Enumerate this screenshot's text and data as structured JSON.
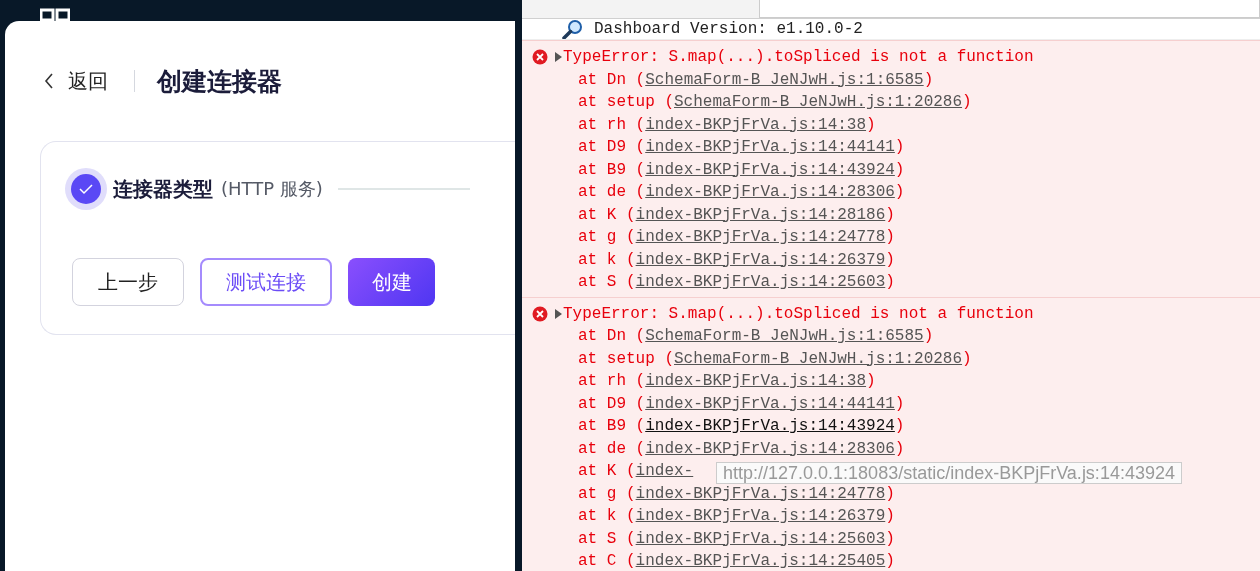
{
  "header": {
    "back_label": "返回",
    "title": "创建连接器"
  },
  "steps": [
    {
      "title": "连接器类型",
      "detail": "(HTTP 服务)",
      "done": true
    }
  ],
  "buttons": [
    {
      "label": "上一步",
      "kind": "default"
    },
    {
      "label": "测试连接",
      "kind": "outline"
    },
    {
      "label": "创建",
      "kind": "primary"
    }
  ],
  "console": {
    "info": "Dashboard Version: e1.10.0-2",
    "errors": [
      {
        "message": "TypeError: S.map(...).toSpliced is not a function",
        "frames": [
          {
            "at": "at Dn (",
            "source": "SchemaForm-B_JeNJwH.js:1:6585",
            "close": ")",
            "hovered": false
          },
          {
            "at": "at setup (",
            "source": "SchemaForm-B_JeNJwH.js:1:20286",
            "close": ")",
            "hovered": false
          },
          {
            "at": "at rh (",
            "source": "index-BKPjFrVa.js:14:38",
            "close": ")",
            "hovered": false
          },
          {
            "at": "at D9 (",
            "source": "index-BKPjFrVa.js:14:44141",
            "close": ")",
            "hovered": false
          },
          {
            "at": "at B9 (",
            "source": "index-BKPjFrVa.js:14:43924",
            "close": ")",
            "hovered": false
          },
          {
            "at": "at de (",
            "source": "index-BKPjFrVa.js:14:28306",
            "close": ")",
            "hovered": false
          },
          {
            "at": "at K (",
            "source": "index-BKPjFrVa.js:14:28186",
            "close": ")",
            "hovered": false
          },
          {
            "at": "at g (",
            "source": "index-BKPjFrVa.js:14:24778",
            "close": ")",
            "hovered": false
          },
          {
            "at": "at k (",
            "source": "index-BKPjFrVa.js:14:26379",
            "close": ")",
            "hovered": false
          },
          {
            "at": "at S (",
            "source": "index-BKPjFrVa.js:14:25603",
            "close": ")",
            "hovered": false
          }
        ]
      },
      {
        "message": "TypeError: S.map(...).toSpliced is not a function",
        "frames": [
          {
            "at": "at Dn (",
            "source": "SchemaForm-B_JeNJwH.js:1:6585",
            "close": ")",
            "hovered": false
          },
          {
            "at": "at setup (",
            "source": "SchemaForm-B_JeNJwH.js:1:20286",
            "close": ")",
            "hovered": false
          },
          {
            "at": "at rh (",
            "source": "index-BKPjFrVa.js:14:38",
            "close": ")",
            "hovered": false
          },
          {
            "at": "at D9 (",
            "source": "index-BKPjFrVa.js:14:44141",
            "close": ")",
            "hovered": false
          },
          {
            "at": "at B9 (",
            "source": "index-BKPjFrVa.js:14:43924",
            "close": ")",
            "hovered": true
          },
          {
            "at": "at de (",
            "source": "index-BKPjFrVa.js:14:28306",
            "close": ")",
            "hovered": false
          },
          {
            "at": "at K (",
            "source": "index-",
            "hovered": false
          },
          {
            "at": "at g (",
            "source": "index-BKPjFrVa.js:14:24778",
            "close": ")",
            "hovered": false
          },
          {
            "at": "at k (",
            "source": "index-BKPjFrVa.js:14:26379",
            "close": ")",
            "hovered": false
          },
          {
            "at": "at S (",
            "source": "index-BKPjFrVa.js:14:25603",
            "close": ")",
            "hovered": false
          },
          {
            "at": "at C (",
            "source": "index-BKPjFrVa.js:14:25405",
            "close": ")",
            "hovered": false
          }
        ]
      }
    ],
    "tooltip": "http://127.0.0.1:18083/static/index-BKPjFrVa.js:14:43924"
  }
}
